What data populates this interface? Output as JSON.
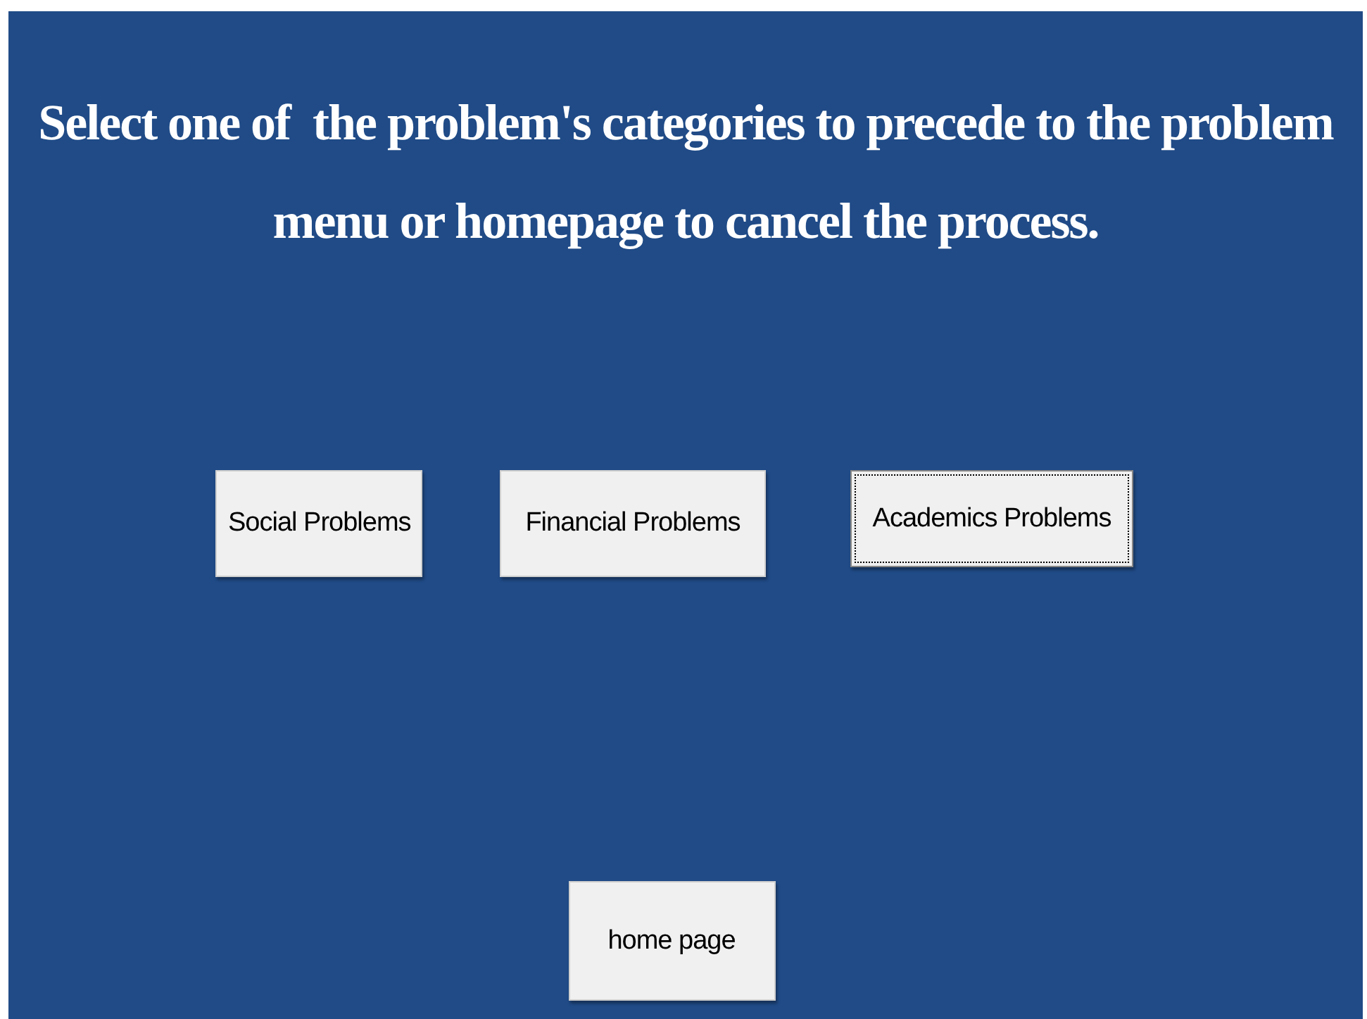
{
  "heading": "Select one of  the problem's categories to precede to the problem menu or homepage to cancel the process.",
  "category_buttons": [
    {
      "label": "Social Problems",
      "focused": false
    },
    {
      "label": "Financial Problems",
      "focused": false
    },
    {
      "label": "Academics Problems",
      "focused": true
    }
  ],
  "home_button": {
    "label": "home page",
    "focused": false
  }
}
